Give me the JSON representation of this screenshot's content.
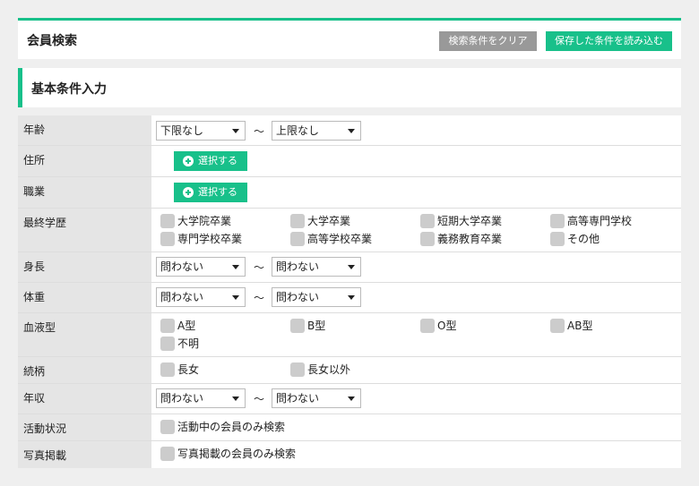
{
  "header": {
    "title": "会員検索",
    "clear_button": "検索条件をクリア",
    "load_button": "保存した条件を読み込む"
  },
  "section": {
    "title": "基本条件入力"
  },
  "tilde": "〜",
  "rows": {
    "age": {
      "label": "年齢",
      "from": "下限なし",
      "to": "上限なし"
    },
    "address": {
      "label": "住所",
      "button": "選択する"
    },
    "occupation": {
      "label": "職業",
      "button": "選択する"
    },
    "education": {
      "label": "最終学歴",
      "options": [
        "大学院卒業",
        "大学卒業",
        "短期大学卒業",
        "高等専門学校",
        "専門学校卒業",
        "高等学校卒業",
        "義務教育卒業",
        "その他"
      ]
    },
    "height": {
      "label": "身長",
      "from": "問わない",
      "to": "問わない"
    },
    "weight": {
      "label": "体重",
      "from": "問わない",
      "to": "問わない"
    },
    "blood": {
      "label": "血液型",
      "options": [
        "A型",
        "B型",
        "O型",
        "AB型",
        "不明"
      ]
    },
    "relation": {
      "label": "続柄",
      "options": [
        "長女",
        "長女以外"
      ]
    },
    "income": {
      "label": "年収",
      "from": "問わない",
      "to": "問わない"
    },
    "activity": {
      "label": "活動状況",
      "option": "活動中の会員のみ検索"
    },
    "photo": {
      "label": "写真掲載",
      "option": "写真掲載の会員のみ検索"
    }
  }
}
